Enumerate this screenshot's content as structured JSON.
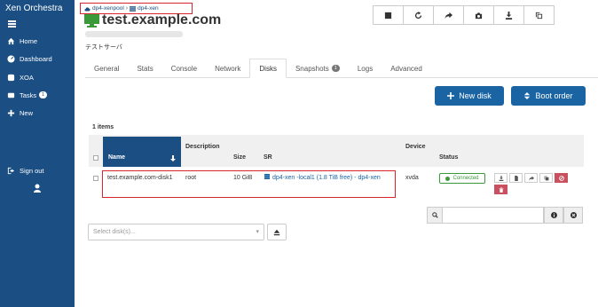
{
  "sidebar": {
    "brand": "Xen Orchestra",
    "items": [
      {
        "label": "Home",
        "icon": "home-icon"
      },
      {
        "label": "Dashboard",
        "icon": "dashboard-icon"
      },
      {
        "label": "XOA",
        "icon": "xoa-icon"
      },
      {
        "label": "Tasks",
        "icon": "tasks-icon",
        "badge": "1"
      },
      {
        "label": "New",
        "icon": "plus-icon"
      },
      {
        "label": "Sign out",
        "icon": "sign-out-icon"
      }
    ]
  },
  "breadcrumb": {
    "pool": "dp4-xenpool",
    "host": "dp4-xen"
  },
  "vm": {
    "name": "test.example.com",
    "description": "テストサーバ"
  },
  "tabs": [
    {
      "label": "General"
    },
    {
      "label": "Stats"
    },
    {
      "label": "Console"
    },
    {
      "label": "Network"
    },
    {
      "label": "Disks",
      "active": true
    },
    {
      "label": "Snapshots",
      "badge": "1"
    },
    {
      "label": "Logs"
    },
    {
      "label": "Advanced"
    }
  ],
  "actions": {
    "new_disk": "New disk",
    "boot_order": "Boot order"
  },
  "table": {
    "count": "1 items",
    "headers": {
      "name": "Name",
      "description": "Description",
      "size": "Size",
      "sr": "SR",
      "device": "Device",
      "status": "Status"
    },
    "rows": [
      {
        "name": "test.example.com-disk1",
        "description": "root",
        "size": "10 GiB",
        "sr": "dp4-xen  -local1 (1.8 TiB free) - dp4-xen",
        "device": "xvda",
        "status": "Connected"
      }
    ]
  },
  "filter": {
    "placeholder": ""
  },
  "disk_select": {
    "placeholder": "Select disk(s)..."
  },
  "colors": {
    "sidebar": "#1b4f84",
    "primary_button": "#1b64a4",
    "highlight": "#d9262c",
    "connected": "#3a9a3a",
    "danger": "#c9515f"
  }
}
